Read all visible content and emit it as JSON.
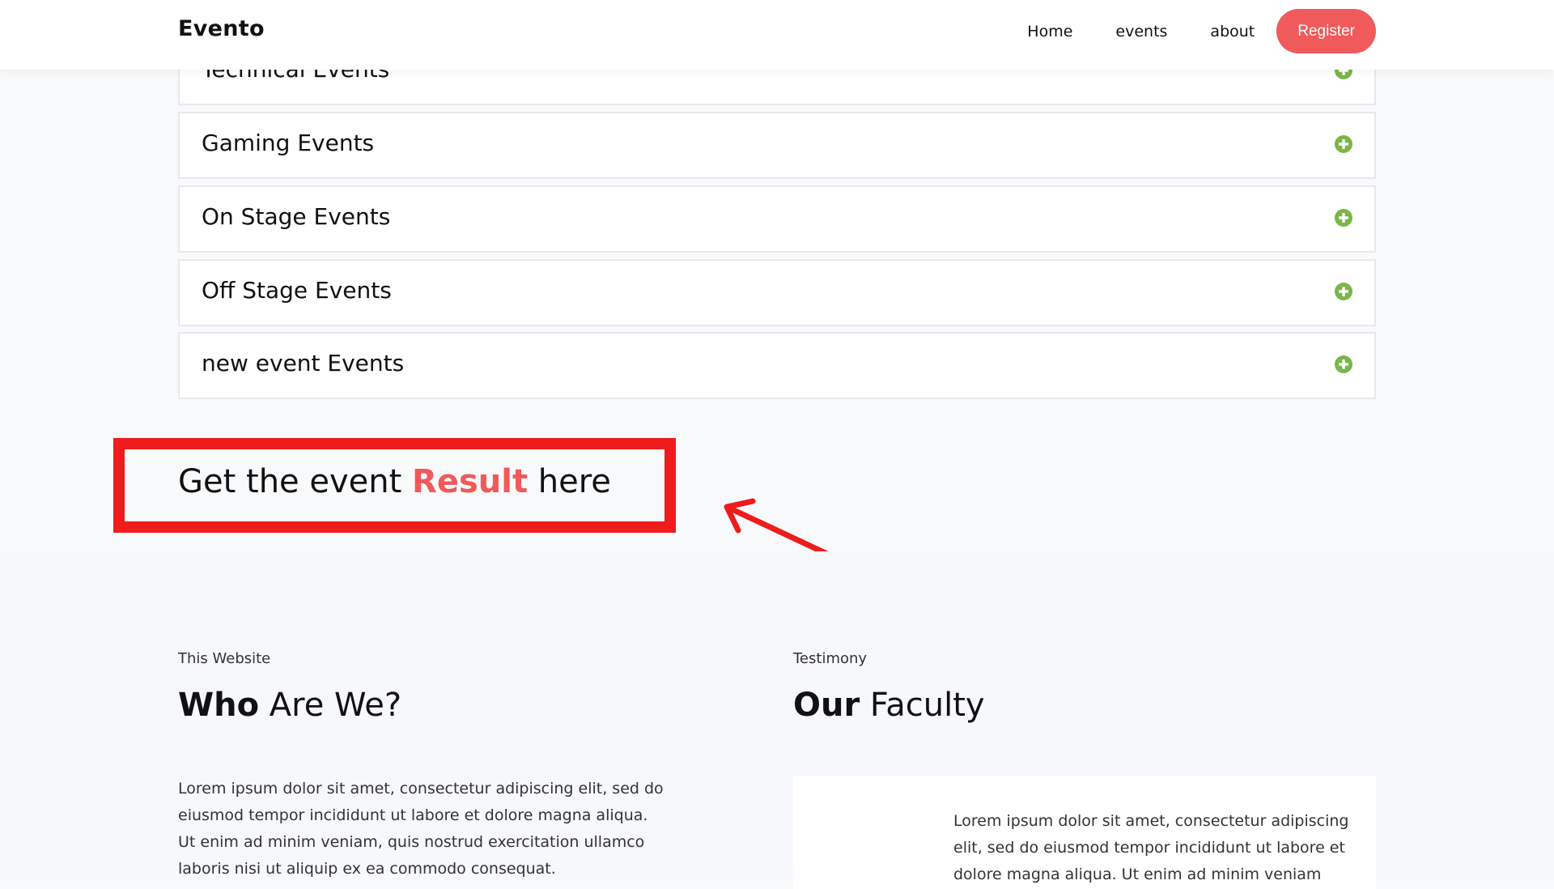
{
  "nav": {
    "brand": "Evento",
    "links": [
      "Home",
      "events",
      "about"
    ],
    "register": "Register"
  },
  "accordion": {
    "items": [
      {
        "title": "Technical Events"
      },
      {
        "title": "Gaming Events"
      },
      {
        "title": "On Stage Events"
      },
      {
        "title": "Off Stage Events"
      },
      {
        "title": "new event Events"
      }
    ],
    "toggle_icon": "plus-circle-icon",
    "toggle_color": "#7ab648"
  },
  "result": {
    "prefix": "Get the event ",
    "highlight": "Result",
    "suffix": " here",
    "highlight_color": "#f05a5a",
    "annotation_color": "#ee1c1c"
  },
  "about": {
    "kicker": "This Website",
    "title_bold": "Who",
    "title_rest": " Are We?",
    "text": "Lorem ipsum dolor sit amet, consectetur adipiscing elit, sed do eiusmod tempor incididunt ut labore et dolore magna aliqua. Ut enim ad minim veniam, quis nostrud exercitation ullamco laboris nisi ut aliquip ex ea commodo consequat."
  },
  "faculty": {
    "kicker": "Testimony",
    "title_bold": "Our",
    "title_rest": " Faculty",
    "text": "Lorem ipsum dolor sit amet, consectetur adipiscing elit, sed do eiusmod tempor incididunt ut labore et dolore magna aliqua. Ut enim ad minim veniam"
  },
  "colors": {
    "brand_red": "#f05a5a",
    "accent_green": "#7ab648"
  }
}
